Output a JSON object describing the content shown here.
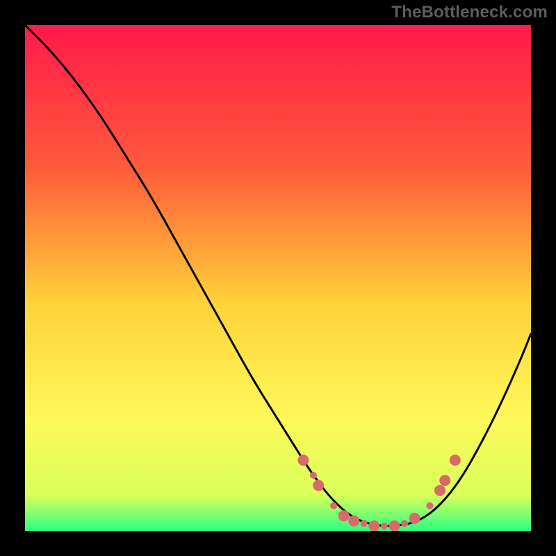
{
  "watermark": "TheBottleneck.com",
  "chart_data": {
    "type": "line",
    "title": "",
    "xlabel": "",
    "ylabel": "",
    "xlim": [
      0,
      100
    ],
    "ylim": [
      0,
      100
    ],
    "gradient_stops": [
      {
        "offset": 0,
        "color": "#ff1a4b"
      },
      {
        "offset": 0.28,
        "color": "#ff5a3a"
      },
      {
        "offset": 0.55,
        "color": "#ffd23a"
      },
      {
        "offset": 0.78,
        "color": "#fff95a"
      },
      {
        "offset": 0.93,
        "color": "#d8ff5a"
      },
      {
        "offset": 1.0,
        "color": "#2aff84"
      }
    ],
    "series": [
      {
        "name": "bottleneck-curve",
        "x": [
          0,
          5,
          10,
          15,
          20,
          25,
          30,
          35,
          40,
          45,
          50,
          55,
          57,
          60,
          63,
          66,
          70,
          74,
          78,
          82,
          86,
          90,
          94,
          98,
          100
        ],
        "y": [
          100,
          95,
          89,
          82,
          74,
          66,
          57,
          48,
          39,
          30,
          22,
          14,
          11,
          7,
          4,
          2,
          1,
          1,
          2,
          5,
          10,
          17,
          25,
          34,
          39
        ]
      }
    ],
    "markers": {
      "name": "highlight-points",
      "color": "#d86a6a",
      "radius_small": 5,
      "radius_large": 8,
      "points": [
        {
          "x": 55,
          "y": 14,
          "r": "large"
        },
        {
          "x": 57,
          "y": 11,
          "r": "small"
        },
        {
          "x": 58,
          "y": 9,
          "r": "large"
        },
        {
          "x": 61,
          "y": 5,
          "r": "small"
        },
        {
          "x": 63,
          "y": 3,
          "r": "large"
        },
        {
          "x": 65,
          "y": 2,
          "r": "large"
        },
        {
          "x": 67,
          "y": 1.5,
          "r": "small"
        },
        {
          "x": 69,
          "y": 1,
          "r": "large"
        },
        {
          "x": 71,
          "y": 1,
          "r": "small"
        },
        {
          "x": 73,
          "y": 1,
          "r": "large"
        },
        {
          "x": 75,
          "y": 1.5,
          "r": "small"
        },
        {
          "x": 77,
          "y": 2.5,
          "r": "large"
        },
        {
          "x": 80,
          "y": 5,
          "r": "small"
        },
        {
          "x": 82,
          "y": 8,
          "r": "large"
        },
        {
          "x": 83,
          "y": 10,
          "r": "large"
        },
        {
          "x": 85,
          "y": 14,
          "r": "large"
        }
      ]
    }
  }
}
